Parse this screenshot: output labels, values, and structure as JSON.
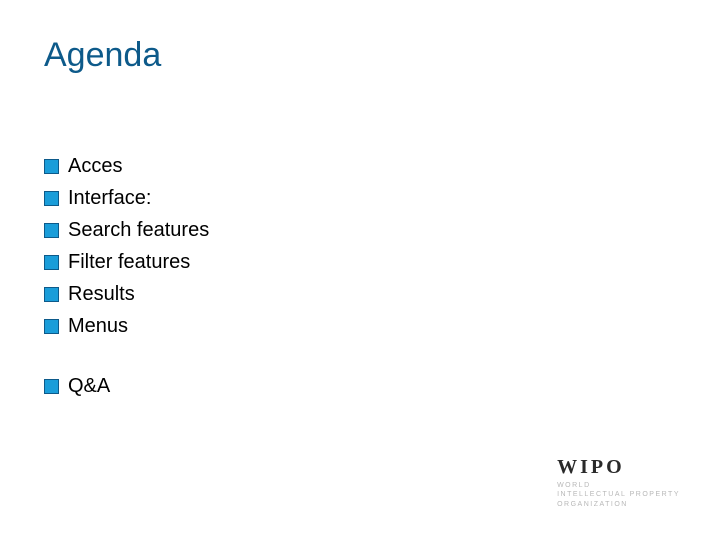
{
  "title": "Agenda",
  "items": [
    {
      "label": "Acces"
    },
    {
      "label": "Interface:"
    }
  ],
  "subitems": [
    {
      "label": "Search features"
    },
    {
      "label": "Filter features"
    },
    {
      "label": "Results"
    },
    {
      "label": "Menus"
    }
  ],
  "tail": [
    {
      "label": "Q&A"
    }
  ],
  "footer": {
    "logo": "WIPO",
    "line1": "WORLD",
    "line2": "INTELLECTUAL PROPERTY",
    "line3": "ORGANIZATION"
  }
}
